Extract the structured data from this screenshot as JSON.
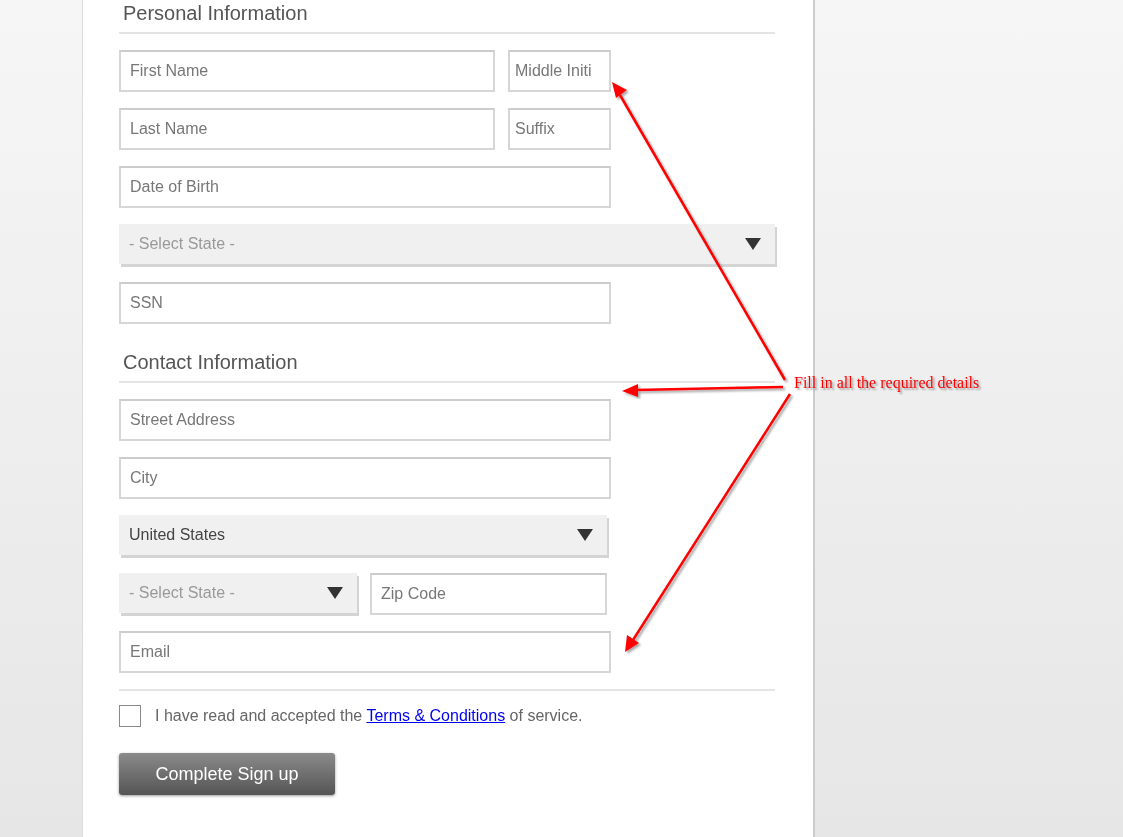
{
  "sections": [
    {
      "heading": "Personal Information",
      "rows": [
        [
          {
            "kind": "input",
            "placeholder": "First Name"
          },
          {
            "kind": "input",
            "placeholder": "Middle Initi"
          }
        ],
        [
          {
            "kind": "input",
            "placeholder": "Last Name"
          },
          {
            "kind": "input",
            "placeholder": "Suffix"
          }
        ],
        [
          {
            "kind": "input",
            "placeholder": "Date of Birth"
          }
        ],
        [
          {
            "kind": "select",
            "placeholder": "- Select State -"
          }
        ],
        [
          {
            "kind": "input",
            "placeholder": "SSN"
          }
        ]
      ]
    },
    {
      "heading": "Contact Information",
      "rows": [
        [
          {
            "kind": "input",
            "placeholder": "Street Address"
          }
        ],
        [
          {
            "kind": "input",
            "placeholder": "City"
          }
        ],
        [
          {
            "kind": "select",
            "value": "United States"
          }
        ],
        [
          {
            "kind": "select",
            "placeholder": "- Select State -"
          },
          {
            "kind": "input",
            "placeholder": "Zip Code"
          }
        ],
        [
          {
            "kind": "input",
            "placeholder": "Email"
          }
        ]
      ]
    }
  ],
  "terms": {
    "checked": false,
    "before": "I have read and accepted the",
    "link": "Terms & Conditions",
    "after": "of service."
  },
  "submit": "Complete Sign up",
  "annotation": "Fill in all the required details"
}
